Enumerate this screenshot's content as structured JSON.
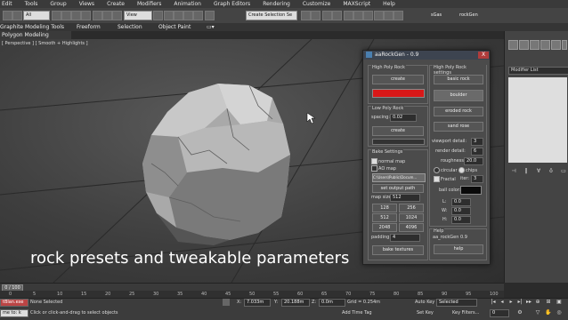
{
  "menu": [
    "Edit",
    "Tools",
    "Group",
    "Views",
    "Create",
    "Modifiers",
    "Animation",
    "Graph Editors",
    "Rendering",
    "Customize",
    "MAXScript",
    "Help"
  ],
  "toolbar": {
    "selection_filter": "All",
    "view_dropdown": "View",
    "selection_set": "Create Selection Se",
    "label_a": "sGas",
    "label_b": "rockGen"
  },
  "ribbon": {
    "tabs": [
      "Graphite Modeling Tools",
      "Freeform",
      "Selection",
      "Object Paint"
    ],
    "sub_tab": "Polygon Modeling"
  },
  "viewport": {
    "label": "[ Perspective ] [ Smooth + Highlights ]"
  },
  "dialog": {
    "title": "aaRockGen - 0.9",
    "close_label": "X",
    "high_poly": {
      "title": "High Poly Rock",
      "create_label": "create",
      "color": "#d81818"
    },
    "low_poly": {
      "title": "Low Poly Rock",
      "spacing_label": "spacing:",
      "spacing_value": "0.02",
      "create_label": "create"
    },
    "bake": {
      "title": "Bake Settings",
      "normal_map": "normal map",
      "ao_map": "AO map",
      "path_value": "C:\\Users\\Public\\Docum...",
      "set_path_label": "set output path",
      "mapsize_label": "map size:",
      "mapsize_value": "512",
      "sizes": [
        "128",
        "256",
        "512",
        "1024",
        "2048",
        "4096"
      ],
      "padding_label": "padding:",
      "padding_value": "4",
      "bake_label": "bake textures"
    },
    "settings": {
      "title": "High Poly Rock settings",
      "basic_rock": "basic rock",
      "boulder": "boulder",
      "eroded_rock": "eroded rock",
      "sand_rose": "sand rose",
      "viewport_detail_label": "viewport detail:",
      "viewport_detail_value": "3",
      "render_detail_label": "render detail:",
      "render_detail_value": "6",
      "roughness_label": "roughness:",
      "roughness_value": "20.0",
      "circular": "circular",
      "chips": "chips",
      "fractal": "Fractal",
      "iter_label": "iter:",
      "iter_value": "3",
      "ball_color_label": "ball color:",
      "ball_color": "#0a0a0a",
      "l_label": "L:",
      "l_value": "0.0",
      "w_label": "W:",
      "w_value": "0.0",
      "h_label": "H:",
      "h_value": "0.0"
    },
    "help": {
      "title": "Help",
      "version": "aa_rockGen 0.9",
      "help_label": "help"
    }
  },
  "caption": "rock presets and tweakable parameters",
  "command_panel": {
    "modifier_list": "Modifier List"
  },
  "timeline": {
    "frame": "0 / 100",
    "ticks": [
      "0",
      "5",
      "10",
      "15",
      "20",
      "25",
      "30",
      "35",
      "40",
      "45",
      "50",
      "55",
      "60",
      "65",
      "70",
      "75",
      "80",
      "85",
      "90",
      "95",
      "100"
    ]
  },
  "status": {
    "selection": "None Selected",
    "prompt": "Click or click-and-drag to select objects",
    "x_label": "X:",
    "x_value": "7.033m",
    "y_label": "Y:",
    "y_value": "20.188m",
    "z_label": "Z:",
    "z_value": "0.0m",
    "grid": "Grid = 0.254m",
    "add_time_tag": "Add Time Tag",
    "auto_key": "Auto Key",
    "key_mode": "Selected",
    "set_key": "Set Key",
    "key_filters": "Key Filters...",
    "frame_value": "0",
    "left_field_a": "tBlan.exe",
    "left_field_b": "me to: k"
  }
}
